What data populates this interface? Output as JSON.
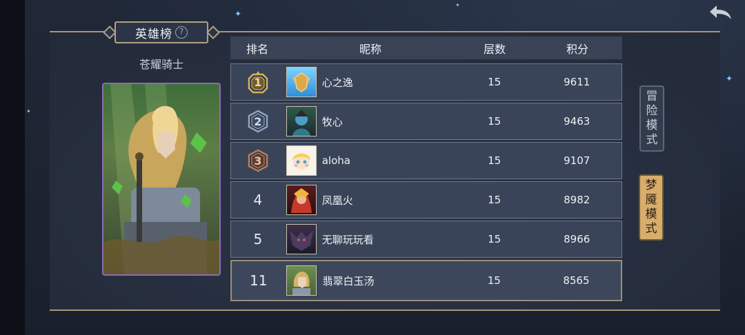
{
  "title": "英雄榜",
  "hero": {
    "name": "苍耀骑士"
  },
  "table": {
    "headers": {
      "rank": "排名",
      "nickname": "昵称",
      "floor": "层数",
      "score": "积分"
    },
    "rows": [
      {
        "rank": "1",
        "nickname": "心之逸",
        "floor": "15",
        "score": "9611",
        "medal": "gold"
      },
      {
        "rank": "2",
        "nickname": "牧心",
        "floor": "15",
        "score": "9463",
        "medal": "silver"
      },
      {
        "rank": "3",
        "nickname": "aloha",
        "floor": "15",
        "score": "9107",
        "medal": "bronze"
      },
      {
        "rank": "4",
        "nickname": "凤凰火",
        "floor": "15",
        "score": "8982"
      },
      {
        "rank": "5",
        "nickname": "无聊玩玩看",
        "floor": "15",
        "score": "8966"
      }
    ],
    "self_row": {
      "rank": "11",
      "nickname": "翡翠白玉汤",
      "floor": "15",
      "score": "8565"
    }
  },
  "modes": {
    "adventure": [
      "冒",
      "险",
      "模",
      "式"
    ],
    "nightmare": [
      "梦",
      "魇",
      "模",
      "式"
    ]
  },
  "colors": {
    "gold": "#d9b15e",
    "silver": "#8fa6c2",
    "bronze": "#c07b55",
    "nightmare_active": "#d8ad6a"
  },
  "icons": {
    "back": "back-arrow-icon",
    "help": "help-icon"
  }
}
